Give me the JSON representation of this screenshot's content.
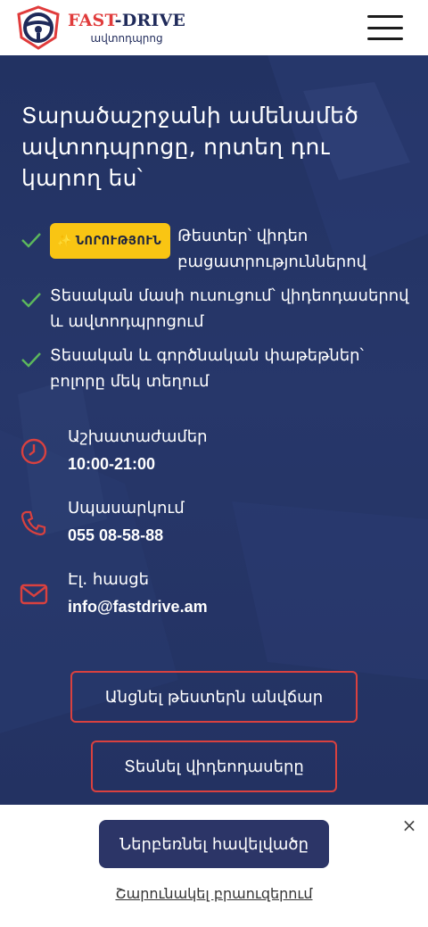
{
  "header": {
    "brand_fast": "FAST",
    "brand_drive": "-DRIVE",
    "brand_sub": "ավտոդպրոց",
    "menu_icon": "hamburger-menu-icon"
  },
  "hero": {
    "title": "Տարածաշրջանի ամենամեծ ավտոդպրոցը, որտեղ դու կարող ես՝",
    "badge": "ՆՈՐՈՒԹՅՈՒՆ",
    "badge_icon": "sparkle-icon",
    "features": [
      "Թեստեր՝ վիդեո բացատրություններով",
      "Տեսական մասի ուսուցում՝ վիդեոդասերով և ավտոդպրոցում",
      "Տեսական և գործնական փաթեթներ՝ բոլորը մեկ տեղում"
    ],
    "check_color": "#4caf50"
  },
  "contacts": [
    {
      "label": "Աշխատաժամեր",
      "value": "10:00-21:00",
      "icon": "clock-icon"
    },
    {
      "label": "Սպասարկում",
      "value": "055 08-58-88",
      "icon": "phone-icon"
    },
    {
      "label": "Էլ. հասցե",
      "value": "info@fastdrive.am",
      "icon": "mail-icon"
    }
  ],
  "buttons": {
    "tests": "Անցնել թեստերն անվճար",
    "videos": "Տեսնել վիդեոդասերը"
  },
  "banner": {
    "install": "Ներբեռնել հավելվածը",
    "close": "×",
    "continue": "Շարունակել բրաուզերում"
  },
  "colors": {
    "accent_red": "#d9413f",
    "navy": "#223262",
    "badge_yellow": "#f9c513"
  }
}
